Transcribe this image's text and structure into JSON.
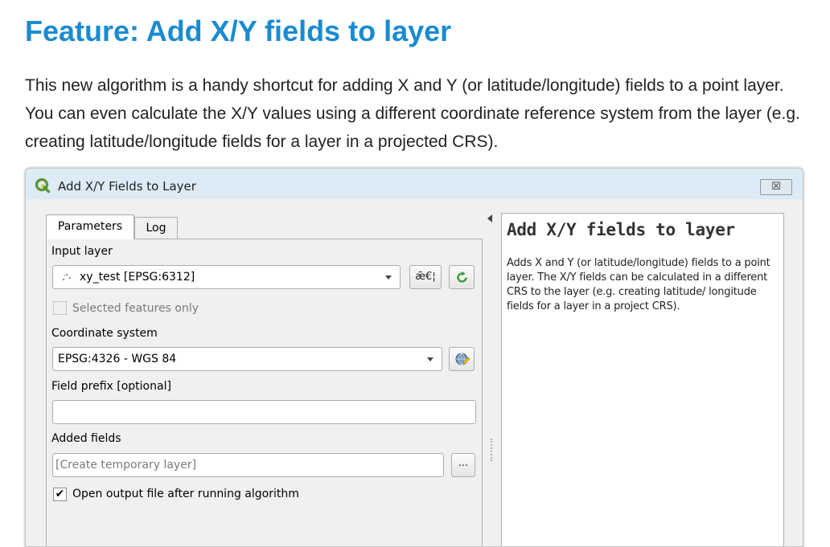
{
  "page": {
    "heading": "Feature: Add X/Y fields to layer",
    "intro": "This new algorithm is a handy shortcut for adding X and Y (or latitude/longitude) fields to a point layer. You can even calculate the X/Y values using a different coordinate reference system from the layer (e.g. creating latitude/longitude fields for a layer in a projected CRS)."
  },
  "dialog": {
    "title": "Add X/Y Fields to Layer",
    "close_glyph": "☒",
    "tabs": [
      {
        "label": "Parameters",
        "active": true
      },
      {
        "label": "Log",
        "active": false
      }
    ],
    "input_layer": {
      "label": "Input layer",
      "value": "xy_test [EPSG:6312]",
      "options_glyph": "ǣ€¦"
    },
    "selected_only": {
      "label": "Selected features only",
      "checked": false,
      "enabled": false
    },
    "crs": {
      "label": "Coordinate system",
      "value": "EPSG:4326 - WGS 84"
    },
    "field_prefix": {
      "label": "Field prefix [optional]",
      "value": ""
    },
    "added_fields": {
      "label": "Added fields",
      "placeholder": "[Create temporary layer]",
      "browse_label": "..."
    },
    "open_output": {
      "label": "Open output file after running algorithm",
      "checked": true,
      "check_glyph": "✔"
    },
    "help": {
      "title": "Add X/Y fields to layer",
      "body": "Adds X and Y (or latitude/longitude) fields to a point layer. The X/Y fields can be calculated in a different CRS to the layer (e.g. creating latitude/ longitude fields for a layer in a project CRS)."
    }
  },
  "colors": {
    "heading": "#1a8bd0",
    "titlebar": "#dcebf6",
    "qgis_green": "#589632",
    "qgis_yellow": "#f0c419"
  },
  "icons": [
    "qgis-logo-icon",
    "point-layer-icon",
    "iterate-icon",
    "globe-crs-icon",
    "combo-arrow-icon",
    "collapse-arrow-icon"
  ]
}
